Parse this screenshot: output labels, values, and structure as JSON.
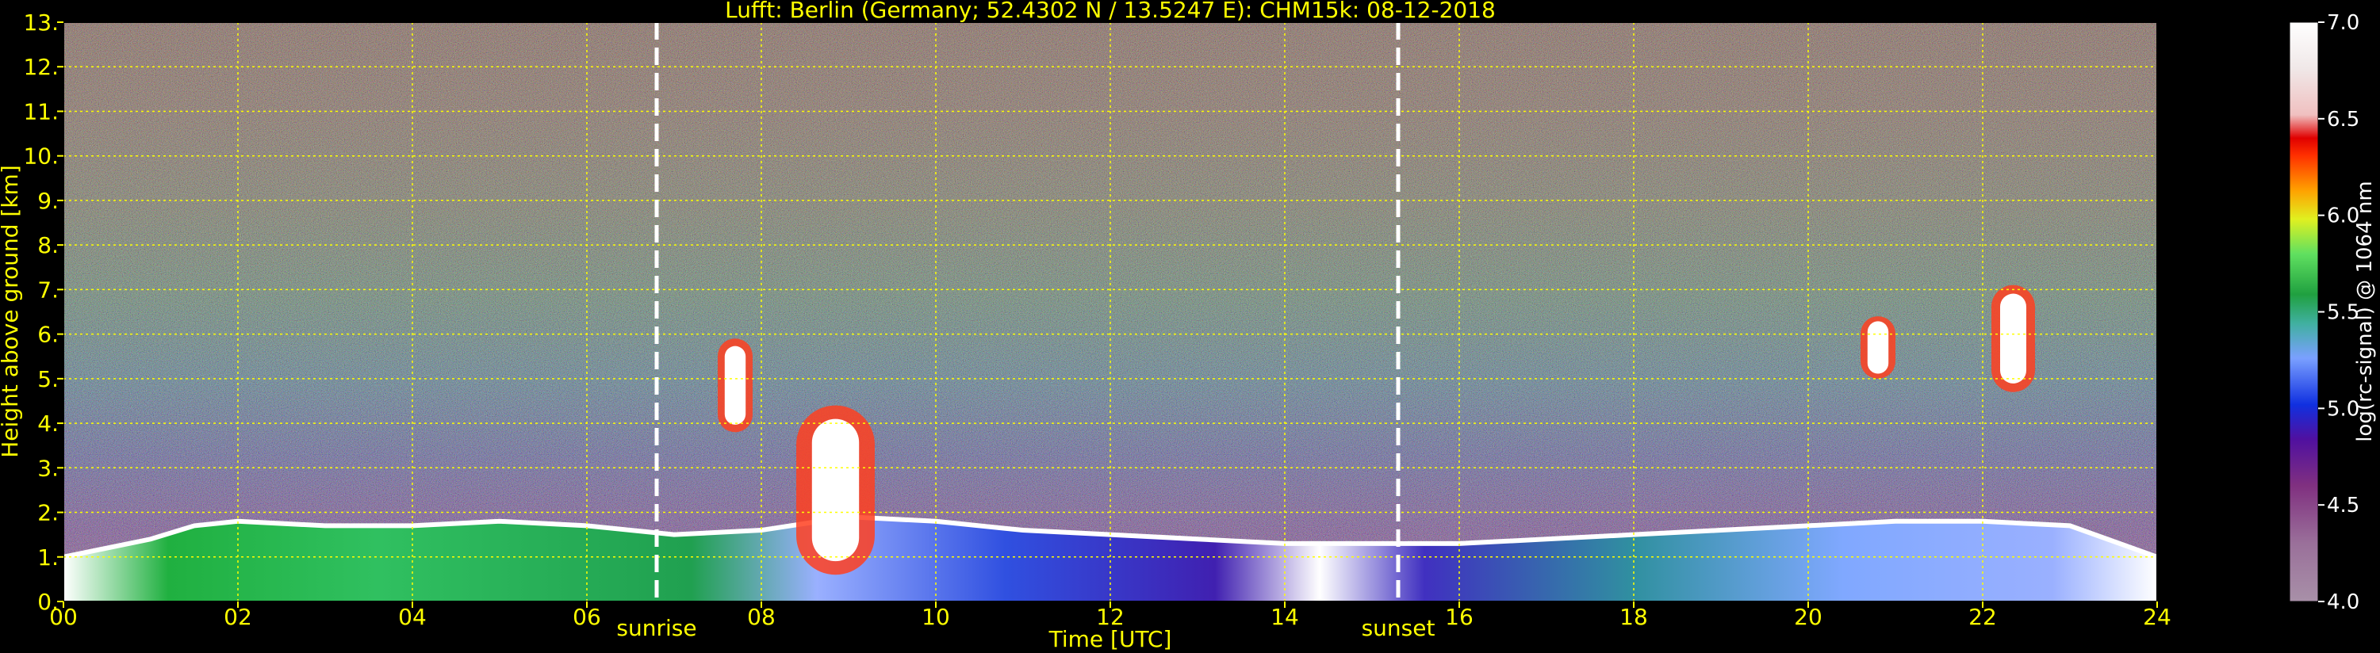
{
  "chart_data": {
    "type": "heatmap",
    "title": "Lufft: Berlin (Germany; 52.4302 N / 13.5247 E):    CHM15k: 08-12-2018",
    "xlabel": "Time [UTC]",
    "ylabel": "Height above ground [km]",
    "x_ticks": [
      "00",
      "02",
      "04",
      "06",
      "08",
      "10",
      "12",
      "14",
      "16",
      "18",
      "20",
      "22",
      "24"
    ],
    "y_ticks": [
      "0.",
      "1.",
      "2.",
      "3.",
      "4.",
      "5.",
      "6.",
      "7.",
      "8.",
      "9.",
      "10.",
      "11.",
      "12.",
      "13."
    ],
    "xlim": [
      0,
      24
    ],
    "ylim": [
      0,
      13
    ],
    "grid": true,
    "annotations": [
      {
        "label": "sunrise",
        "x": 6.8
      },
      {
        "label": "sunset",
        "x": 15.3
      }
    ],
    "colorbar": {
      "label": "log(rc-signal) @ 1064 nm",
      "range": [
        4.0,
        7.0
      ],
      "ticks": [
        "4.0",
        "4.5",
        "5.0",
        "5.5",
        "6.0",
        "6.5",
        "7.0"
      ]
    },
    "cloud_layers": [
      {
        "start": 7.5,
        "end": 7.9,
        "base_km": 3.8,
        "top_km": 5.9
      },
      {
        "start": 8.4,
        "end": 9.3,
        "base_km": 0.6,
        "top_km": 4.4
      },
      {
        "start": 20.6,
        "end": 21.0,
        "base_km": 5.0,
        "top_km": 6.4
      },
      {
        "start": 22.1,
        "end": 22.6,
        "base_km": 4.7,
        "top_km": 7.1
      }
    ],
    "boundary_layer_top_km": [
      [
        0,
        1.0
      ],
      [
        1,
        1.4
      ],
      [
        1.5,
        1.7
      ],
      [
        2,
        1.8
      ],
      [
        3,
        1.7
      ],
      [
        4,
        1.7
      ],
      [
        5,
        1.8
      ],
      [
        6,
        1.7
      ],
      [
        7,
        1.5
      ],
      [
        8,
        1.6
      ],
      [
        9,
        1.9
      ],
      [
        10,
        1.8
      ],
      [
        11,
        1.6
      ],
      [
        12,
        1.5
      ],
      [
        13,
        1.4
      ],
      [
        14,
        1.3
      ],
      [
        15,
        1.3
      ],
      [
        16,
        1.3
      ],
      [
        17,
        1.4
      ],
      [
        18,
        1.5
      ],
      [
        19,
        1.6
      ],
      [
        20,
        1.7
      ],
      [
        21,
        1.8
      ],
      [
        22,
        1.8
      ],
      [
        23,
        1.7
      ],
      [
        24,
        1.0
      ]
    ]
  }
}
